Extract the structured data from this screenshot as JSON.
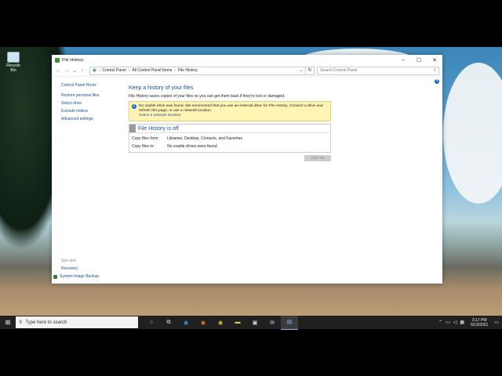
{
  "desktop": {
    "icon_label": "Recycle Bin"
  },
  "window": {
    "title": "File History",
    "controls": {
      "minimize": "–",
      "maximize": "☐",
      "close": "✕"
    },
    "address": {
      "crumbs": [
        "Control Panel",
        "All Control Panel Items",
        "File History"
      ],
      "separator": "›"
    },
    "search_placeholder": "Search Control Panel",
    "help": "?"
  },
  "sidebar": {
    "home": "Control Panel Home",
    "links": [
      "Restore personal files",
      "Select drive",
      "Exclude folders",
      "Advanced settings"
    ],
    "see_also_label": "See also",
    "see_also": [
      "Recovery",
      "System Image Backup"
    ]
  },
  "main": {
    "heading": "Keep a history of your files",
    "description": "File History saves copies of your files so you can get them back if they're lost or damaged.",
    "warning": {
      "text": "No usable drive was found. We recommend that you use an external drive for File History. Connect a drive and refresh this page, or use a network location.",
      "link": "Select a network location"
    },
    "status_title": "File History is off",
    "copy_from_label": "Copy files from:",
    "copy_from_value": "Libraries, Desktop, Contacts, and Favorites",
    "copy_to_label": "Copy files to:",
    "copy_to_value": "No usable drives were found.",
    "turn_on": "Turn on"
  },
  "taskbar": {
    "search_placeholder": "Type here to search",
    "time": "3:17 PM",
    "date": "6/13/2021"
  }
}
